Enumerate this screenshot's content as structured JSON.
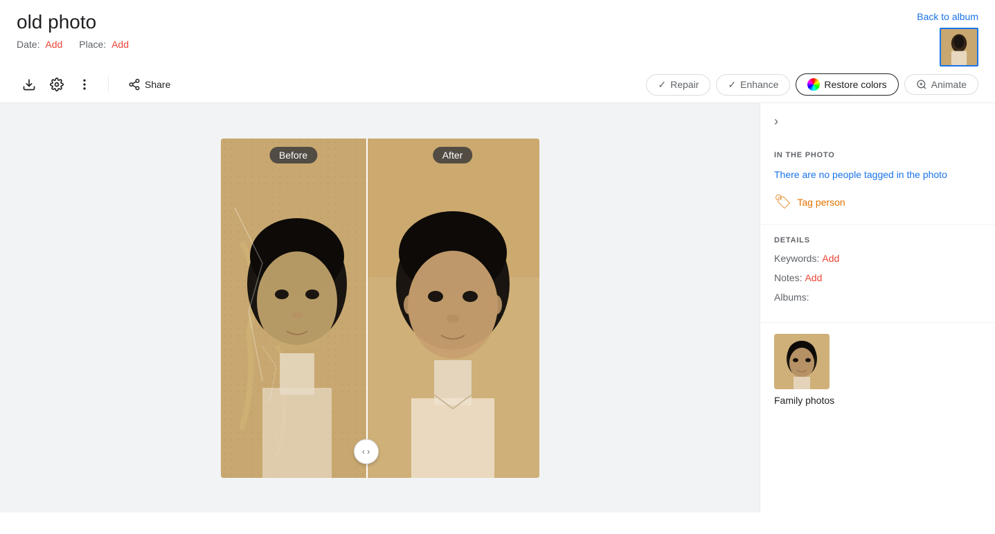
{
  "header": {
    "title": "old photo",
    "date_label": "Date:",
    "date_value": "Add",
    "place_label": "Place:",
    "place_value": "Add",
    "back_to_album": "Back to album"
  },
  "toolbar": {
    "share_label": "Share",
    "repair_label": "Repair",
    "enhance_label": "Enhance",
    "restore_colors_label": "Restore colors",
    "animate_label": "Animate"
  },
  "photo": {
    "before_label": "Before",
    "after_label": "After",
    "drag_handle": "‹ ›"
  },
  "sidebar": {
    "toggle_icon": "›",
    "in_the_photo_title": "IN THE PHOTO",
    "no_people_text": "There are no people tagged in the photo",
    "tag_person_label": "Tag person",
    "details_title": "DETAILS",
    "keywords_label": "Keywords:",
    "keywords_value": "Add",
    "notes_label": "Notes:",
    "notes_value": "Add",
    "albums_label": "Albums:",
    "album_name": "Family photos"
  },
  "colors": {
    "accent_red": "#ea4335",
    "accent_blue": "#1a73e8",
    "accent_orange": "#e37400",
    "border": "#dadce0",
    "bg_light": "#f1f3f4",
    "text_secondary": "#5f6368"
  }
}
